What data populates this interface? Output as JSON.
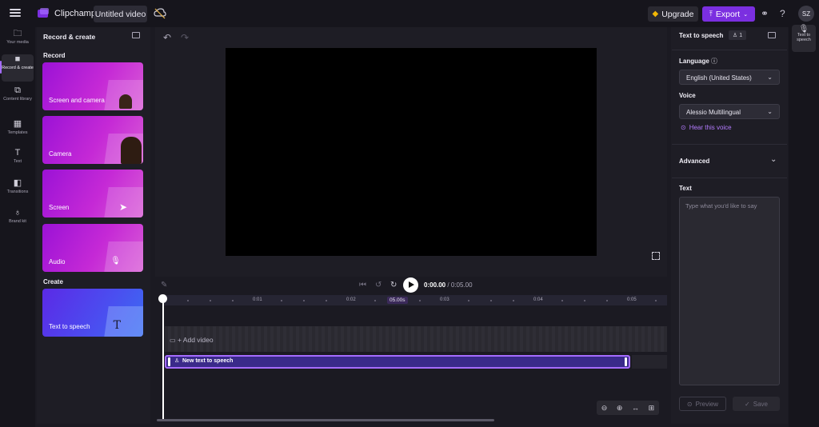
{
  "app": {
    "name": "Clipchamp",
    "project_title": "Untitled video",
    "upgrade_label": "Upgrade",
    "export_label": "Export",
    "avatar_initials": "SZ"
  },
  "left_nav": [
    {
      "label": "Your media",
      "icon": "folder-icon"
    },
    {
      "label": "Record & create",
      "icon": "camera-icon",
      "active": true
    },
    {
      "label": "Content library",
      "icon": "library-icon"
    },
    {
      "label": "Templates",
      "icon": "grid-icon"
    },
    {
      "label": "Text",
      "icon": "text-icon"
    },
    {
      "label": "Transitions",
      "icon": "transitions-icon"
    },
    {
      "label": "Brand kit",
      "icon": "brand-kit-icon"
    }
  ],
  "panel": {
    "title": "Record & create",
    "record_label": "Record",
    "create_label": "Create",
    "record_cards": [
      "Screen and camera",
      "Camera",
      "Screen",
      "Audio"
    ],
    "create_cards": [
      "Text to speech"
    ]
  },
  "playback": {
    "current_time": "0:00.00",
    "duration": "/ 0:05.00"
  },
  "timeline": {
    "ticks": [
      "0:01",
      "0:02",
      "05.00s",
      "0:03",
      "0:04",
      "0:05"
    ],
    "add_video": "+ Add video",
    "tts_clip": "New text to speech"
  },
  "right_panel": {
    "title": "Text to speech",
    "badge": "1",
    "language_label": "Language",
    "language_value": "English (United States)",
    "voice_label": "Voice",
    "voice_value": "Alessio Multilingual",
    "hear_voice": "Hear this voice",
    "advanced_label": "Advanced",
    "text_label": "Text",
    "text_placeholder": "Type what you'd like to say",
    "preview_label": "Preview",
    "save_label": "Save"
  },
  "right_rail": {
    "item_label": "Text to speech"
  },
  "colors": {
    "accent": "#7b2fe0",
    "accent_light": "#a56cff",
    "card_gradient_start": "#9b12d6",
    "tts_card_start": "#5b2ae6"
  }
}
